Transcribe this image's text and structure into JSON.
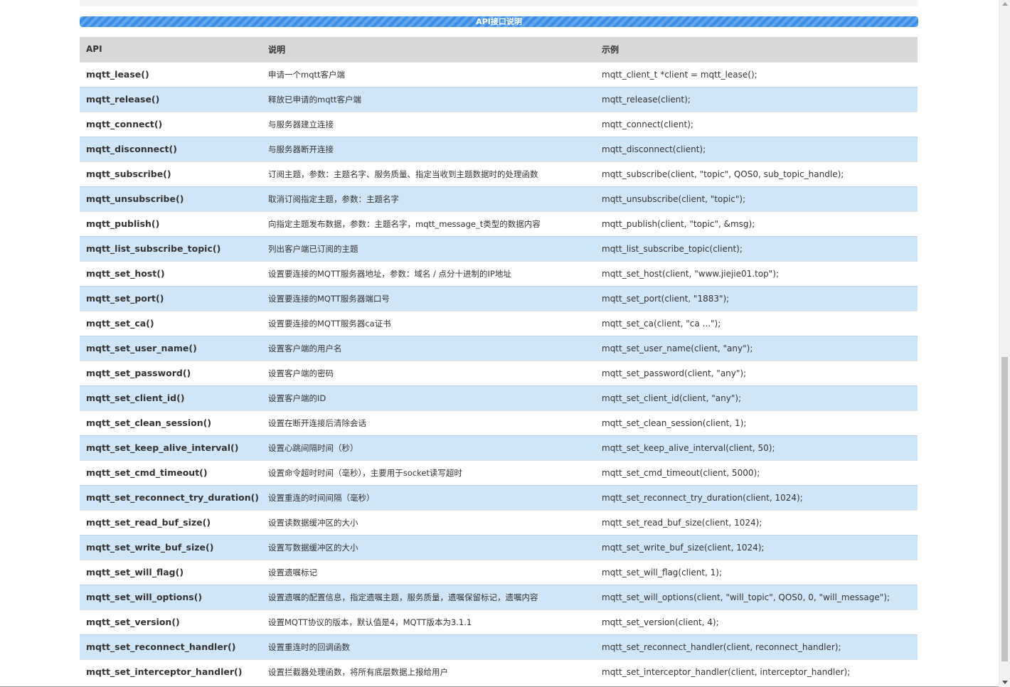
{
  "banner": {
    "title": "API接口说明"
  },
  "table": {
    "headers": {
      "api": "API",
      "desc": "说明",
      "example": "示例"
    },
    "rows": [
      {
        "api": "mqtt_lease()",
        "desc": "申请一个mqtt客户端",
        "example": "mqtt_client_t *client = mqtt_lease();"
      },
      {
        "api": "mqtt_release()",
        "desc": "释放已申请的mqtt客户端",
        "example": "mqtt_release(client);"
      },
      {
        "api": "mqtt_connect()",
        "desc": "与服务器建立连接",
        "example": "mqtt_connect(client);"
      },
      {
        "api": "mqtt_disconnect()",
        "desc": "与服务器断开连接",
        "example": "mqtt_disconnect(client);"
      },
      {
        "api": "mqtt_subscribe()",
        "desc": "订阅主题，参数：主题名字、服务质量、指定当收到主题数据时的处理函数",
        "example": "mqtt_subscribe(client, \"topic\", QOS0, sub_topic_handle);"
      },
      {
        "api": "mqtt_unsubscribe()",
        "desc": "取消订阅指定主题，参数：主题名字",
        "example": "mqtt_unsubscribe(client, \"topic\");"
      },
      {
        "api": "mqtt_publish()",
        "desc": "向指定主题发布数据，参数：主题名字，mqtt_message_t类型的数据内容",
        "example": "mqtt_publish(client, \"topic\", &msg);"
      },
      {
        "api": "mqtt_list_subscribe_topic()",
        "desc": "列出客户端已订阅的主题",
        "example": "mqtt_list_subscribe_topic(client);"
      },
      {
        "api": "mqtt_set_host()",
        "desc": "设置要连接的MQTT服务器地址，参数：域名 / 点分十进制的IP地址",
        "example": "mqtt_set_host(client, \"www.jiejie01.top\");"
      },
      {
        "api": "mqtt_set_port()",
        "desc": "设置要连接的MQTT服务器端口号",
        "example": "mqtt_set_port(client, \"1883\");"
      },
      {
        "api": "mqtt_set_ca()",
        "desc": "设置要连接的MQTT服务器ca证书",
        "example": "mqtt_set_ca(client, \"ca ...\");"
      },
      {
        "api": "mqtt_set_user_name()",
        "desc": "设置客户端的用户名",
        "example": "mqtt_set_user_name(client, \"any\");"
      },
      {
        "api": "mqtt_set_password()",
        "desc": "设置客户端的密码",
        "example": "mqtt_set_password(client, \"any\");"
      },
      {
        "api": "mqtt_set_client_id()",
        "desc": "设置客户端的ID",
        "example": "mqtt_set_client_id(client, \"any\");"
      },
      {
        "api": "mqtt_set_clean_session()",
        "desc": "设置在断开连接后清除会话",
        "example": "mqtt_set_clean_session(client, 1);"
      },
      {
        "api": "mqtt_set_keep_alive_interval()",
        "desc": "设置心跳间隔时间（秒）",
        "example": "mqtt_set_keep_alive_interval(client, 50);"
      },
      {
        "api": "mqtt_set_cmd_timeout()",
        "desc": "设置命令超时时间（毫秒），主要用于socket读写超时",
        "example": "mqtt_set_cmd_timeout(client, 5000);"
      },
      {
        "api": "mqtt_set_reconnect_try_duration()",
        "desc": "设置重连的时间间隔（毫秒）",
        "example": "mqtt_set_reconnect_try_duration(client, 1024);"
      },
      {
        "api": "mqtt_set_read_buf_size()",
        "desc": "设置读数据缓冲区的大小",
        "example": "mqtt_set_read_buf_size(client, 1024);"
      },
      {
        "api": "mqtt_set_write_buf_size()",
        "desc": "设置写数据缓冲区的大小",
        "example": "mqtt_set_write_buf_size(client, 1024);"
      },
      {
        "api": "mqtt_set_will_flag()",
        "desc": "设置遗嘱标记",
        "example": "mqtt_set_will_flag(client, 1);"
      },
      {
        "api": "mqtt_set_will_options()",
        "desc": "设置遗嘱的配置信息，指定遗嘱主题，服务质量，遗嘱保留标记，遗嘱内容",
        "example": "mqtt_set_will_options(client, \"will_topic\", QOS0, 0, \"will_message\");"
      },
      {
        "api": "mqtt_set_version()",
        "desc": "设置MQTT协议的版本，默认值是4，MQTT版本为3.1.1",
        "example": "mqtt_set_version(client, 4);"
      },
      {
        "api": "mqtt_set_reconnect_handler()",
        "desc": "设置重连时的回调函数",
        "example": "mqtt_set_reconnect_handler(client, reconnect_handler);"
      },
      {
        "api": "mqtt_set_interceptor_handler()",
        "desc": "设置拦截器处理函数，将所有底层数据上报给用户",
        "example": "mqtt_set_interceptor_handler(client, interceptor_handler);"
      }
    ]
  }
}
